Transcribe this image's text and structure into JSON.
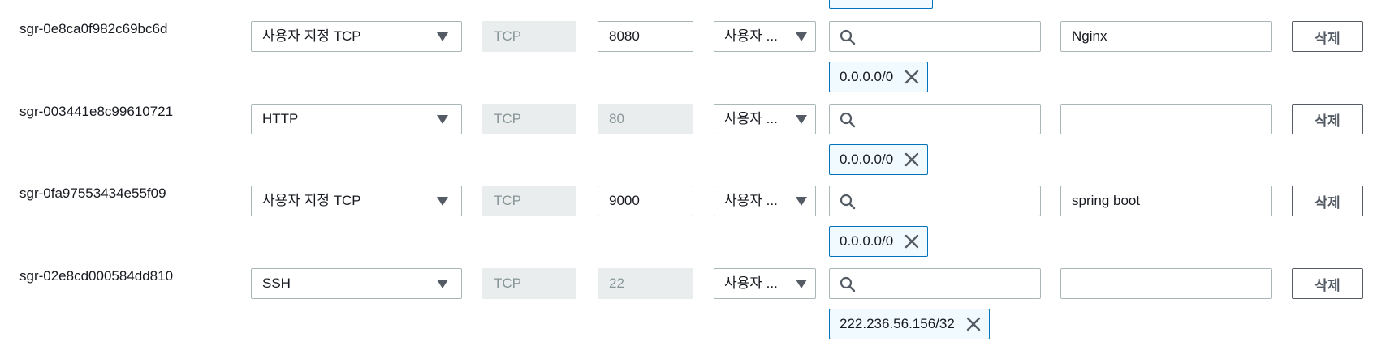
{
  "rules": [
    {
      "id": "sgr-0e8ca0f982c69bc6d",
      "type": "사용자 지정 TCP",
      "protocol": "TCP",
      "port": "8080",
      "port_editable": true,
      "source_type": "사용자 ...",
      "search_value": "",
      "cidr": "0.0.0.0/0",
      "description": "Nginx",
      "delete_label": "삭제"
    },
    {
      "id": "sgr-003441e8c99610721",
      "type": "HTTP",
      "protocol": "TCP",
      "port": "80",
      "port_editable": false,
      "source_type": "사용자 ...",
      "search_value": "",
      "cidr": "0.0.0.0/0",
      "description": "",
      "delete_label": "삭제"
    },
    {
      "id": "sgr-0fa97553434e55f09",
      "type": "사용자 지정 TCP",
      "protocol": "TCP",
      "port": "9000",
      "port_editable": true,
      "source_type": "사용자 ...",
      "search_value": "",
      "cidr": "0.0.0.0/0",
      "description": "spring boot",
      "delete_label": "삭제"
    },
    {
      "id": "sgr-02e8cd000584dd810",
      "type": "SSH",
      "protocol": "TCP",
      "port": "22",
      "port_editable": false,
      "source_type": "사용자 ...",
      "search_value": "",
      "cidr": "222.236.56.156/32",
      "description": "",
      "delete_label": "삭제"
    }
  ],
  "colors": {
    "chip_border": "#0073bb",
    "chip_bg": "#f1faff",
    "input_border": "#aab7b8",
    "disabled_bg": "#eaeded",
    "disabled_text": "#879596"
  },
  "icons": {
    "search": "search-icon",
    "close": "close-icon",
    "dropdown": "caret-down-icon"
  }
}
